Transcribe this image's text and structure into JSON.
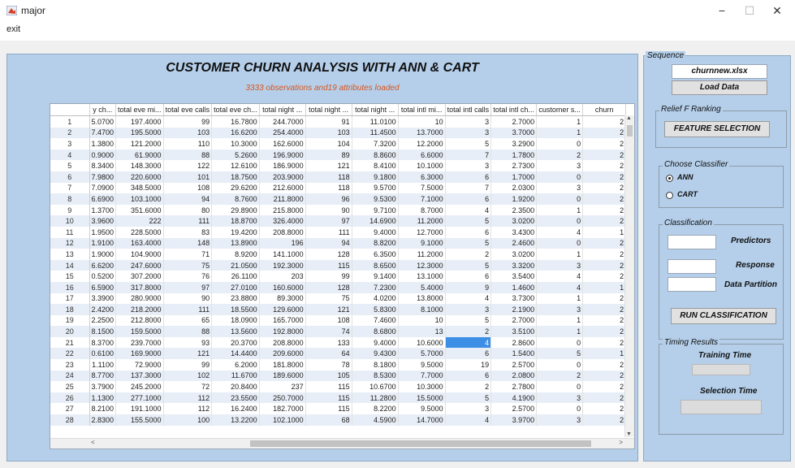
{
  "window": {
    "title": "major",
    "minimize": "−",
    "maximize": "☐",
    "close": "✕"
  },
  "menu": {
    "exit": "exit"
  },
  "main": {
    "title": "CUSTOMER CHURN ANALYSIS WITH ANN & CART",
    "status": "3333 observations and19 attributes loaded"
  },
  "table": {
    "headers": [
      "",
      "y ch...",
      "total eve mi...",
      "total eve calls",
      "total eve ch...",
      "total night ...",
      "total night ...",
      "total night ...",
      "total intl mi...",
      "total intl calls",
      "total intl ch...",
      "customer s...",
      "churn"
    ],
    "rows": [
      [
        "1",
        "5.0700",
        "197.4000",
        "99",
        "16.7800",
        "244.7000",
        "91",
        "11.0100",
        "10",
        "3",
        "2.7000",
        "1",
        "2"
      ],
      [
        "2",
        "7.4700",
        "195.5000",
        "103",
        "16.6200",
        "254.4000",
        "103",
        "11.4500",
        "13.7000",
        "3",
        "3.7000",
        "1",
        "2"
      ],
      [
        "3",
        "1.3800",
        "121.2000",
        "110",
        "10.3000",
        "162.6000",
        "104",
        "7.3200",
        "12.2000",
        "5",
        "3.2900",
        "0",
        "2"
      ],
      [
        "4",
        "0.9000",
        "61.9000",
        "88",
        "5.2600",
        "196.9000",
        "89",
        "8.8600",
        "6.6000",
        "7",
        "1.7800",
        "2",
        "2"
      ],
      [
        "5",
        "8.3400",
        "148.3000",
        "122",
        "12.6100",
        "186.9000",
        "121",
        "8.4100",
        "10.1000",
        "3",
        "2.7300",
        "3",
        "2"
      ],
      [
        "6",
        "7.9800",
        "220.6000",
        "101",
        "18.7500",
        "203.9000",
        "118",
        "9.1800",
        "6.3000",
        "6",
        "1.7000",
        "0",
        "2"
      ],
      [
        "7",
        "7.0900",
        "348.5000",
        "108",
        "29.6200",
        "212.6000",
        "118",
        "9.5700",
        "7.5000",
        "7",
        "2.0300",
        "3",
        "2"
      ],
      [
        "8",
        "6.6900",
        "103.1000",
        "94",
        "8.7600",
        "211.8000",
        "96",
        "9.5300",
        "7.1000",
        "6",
        "1.9200",
        "0",
        "2"
      ],
      [
        "9",
        "1.3700",
        "351.6000",
        "80",
        "29.8900",
        "215.8000",
        "90",
        "9.7100",
        "8.7000",
        "4",
        "2.3500",
        "1",
        "2"
      ],
      [
        "10",
        "3.9600",
        "222",
        "111",
        "18.8700",
        "326.4000",
        "97",
        "14.6900",
        "11.2000",
        "5",
        "3.0200",
        "0",
        "2"
      ],
      [
        "11",
        "1.9500",
        "228.5000",
        "83",
        "19.4200",
        "208.8000",
        "111",
        "9.4000",
        "12.7000",
        "6",
        "3.4300",
        "4",
        "1"
      ],
      [
        "12",
        "1.9100",
        "163.4000",
        "148",
        "13.8900",
        "196",
        "94",
        "8.8200",
        "9.1000",
        "5",
        "2.4600",
        "0",
        "2"
      ],
      [
        "13",
        "1.9000",
        "104.9000",
        "71",
        "8.9200",
        "141.1000",
        "128",
        "6.3500",
        "11.2000",
        "2",
        "3.0200",
        "1",
        "2"
      ],
      [
        "14",
        "6.6200",
        "247.6000",
        "75",
        "21.0500",
        "192.3000",
        "115",
        "8.6500",
        "12.3000",
        "5",
        "3.3200",
        "3",
        "2"
      ],
      [
        "15",
        "0.5200",
        "307.2000",
        "76",
        "26.1100",
        "203",
        "99",
        "9.1400",
        "13.1000",
        "6",
        "3.5400",
        "4",
        "2"
      ],
      [
        "16",
        "6.5900",
        "317.8000",
        "97",
        "27.0100",
        "160.6000",
        "128",
        "7.2300",
        "5.4000",
        "9",
        "1.4600",
        "4",
        "1"
      ],
      [
        "17",
        "3.3900",
        "280.9000",
        "90",
        "23.8800",
        "89.3000",
        "75",
        "4.0200",
        "13.8000",
        "4",
        "3.7300",
        "1",
        "2"
      ],
      [
        "18",
        "2.4200",
        "218.2000",
        "111",
        "18.5500",
        "129.6000",
        "121",
        "5.8300",
        "8.1000",
        "3",
        "2.1900",
        "3",
        "2"
      ],
      [
        "19",
        "2.2500",
        "212.8000",
        "65",
        "18.0900",
        "165.7000",
        "108",
        "7.4600",
        "10",
        "5",
        "2.7000",
        "1",
        "2"
      ],
      [
        "20",
        "8.1500",
        "159.5000",
        "88",
        "13.5600",
        "192.8000",
        "74",
        "8.6800",
        "13",
        "2",
        "3.5100",
        "1",
        "2"
      ],
      [
        "21",
        "8.3700",
        "239.7000",
        "93",
        "20.3700",
        "208.8000",
        "133",
        "9.4000",
        "10.6000",
        "4",
        "2.8600",
        "0",
        "2"
      ],
      [
        "22",
        "0.6100",
        "169.9000",
        "121",
        "14.4400",
        "209.6000",
        "64",
        "9.4300",
        "5.7000",
        "6",
        "1.5400",
        "5",
        "1"
      ],
      [
        "23",
        "1.1100",
        "72.9000",
        "99",
        "6.2000",
        "181.8000",
        "78",
        "8.1800",
        "9.5000",
        "19",
        "2.5700",
        "0",
        "2"
      ],
      [
        "24",
        "8.7700",
        "137.3000",
        "102",
        "11.6700",
        "189.6000",
        "105",
        "8.5300",
        "7.7000",
        "6",
        "2.0800",
        "2",
        "2"
      ],
      [
        "25",
        "3.7900",
        "245.2000",
        "72",
        "20.8400",
        "237",
        "115",
        "10.6700",
        "10.3000",
        "2",
        "2.7800",
        "0",
        "2"
      ],
      [
        "26",
        "1.1300",
        "277.1000",
        "112",
        "23.5500",
        "250.7000",
        "115",
        "11.2800",
        "15.5000",
        "5",
        "4.1900",
        "3",
        "2"
      ],
      [
        "27",
        "8.2100",
        "191.1000",
        "112",
        "16.2400",
        "182.7000",
        "115",
        "8.2200",
        "9.5000",
        "3",
        "2.5700",
        "0",
        "2"
      ],
      [
        "28",
        "2.8300",
        "155.5000",
        "100",
        "13.2200",
        "102.1000",
        "68",
        "4.5900",
        "14.7000",
        "4",
        "3.9700",
        "3",
        "2"
      ]
    ],
    "selected": {
      "row": 21,
      "col": 9
    },
    "scroll_up": "▲",
    "scroll_down": "▼",
    "scroll_left": "<",
    "scroll_right": ">"
  },
  "sequence": {
    "title": "Sequence",
    "file": "churnnew.xlsx",
    "load_button": "Load Data"
  },
  "relief": {
    "title": "Relief F Ranking",
    "button": "FEATURE SELECTION"
  },
  "classifier": {
    "title": "Choose Classifier",
    "options": [
      "ANN",
      "CART"
    ],
    "selected": "ANN"
  },
  "classification": {
    "title": "Classification",
    "predictors_label": "Predictors",
    "response_label": "Response",
    "partition_label": "Data Partition",
    "run_button": "RUN CLASSIFICATION"
  },
  "timing": {
    "title": "Timing Results",
    "training_label": "Training Time",
    "selection_label": "Selection Time"
  },
  "colors": {
    "panel": "#b5cfea",
    "accent_status": "#d9541e",
    "selection": "#3d8fe6"
  }
}
